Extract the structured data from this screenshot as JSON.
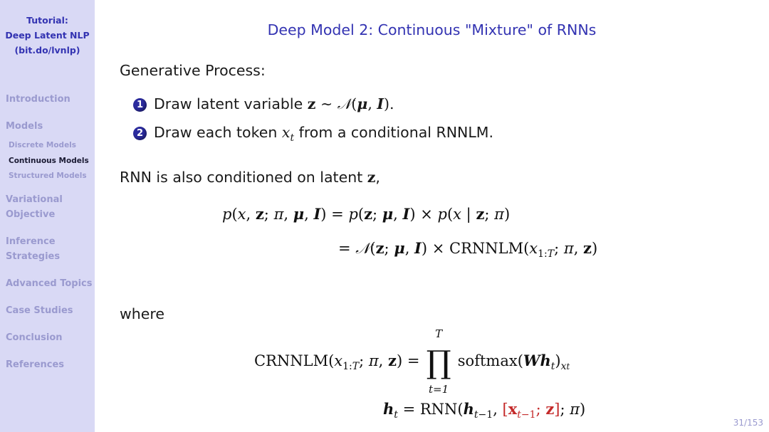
{
  "sidebar": {
    "title_lines": [
      "Tutorial:",
      "Deep Latent NLP",
      "(bit.do/lvnlp)"
    ],
    "sections": [
      {
        "label": "Introduction"
      },
      {
        "label": "Models",
        "subsections": [
          "Discrete Models",
          "Continuous Models",
          "Structured Models"
        ]
      },
      {
        "label_lines": [
          "Variational",
          "Objective"
        ]
      },
      {
        "label_lines": [
          "Inference",
          "Strategies"
        ]
      },
      {
        "label": "Advanced Topics"
      },
      {
        "label": "Case Studies"
      },
      {
        "label": "Conclusion"
      },
      {
        "label": "References"
      }
    ],
    "active_subsection": "Continuous Models"
  },
  "frame": {
    "title": "Deep Model 2: Continuous \"Mixture\" of RNNs",
    "intro": "Generative Process:",
    "steps": [
      {
        "number": "1",
        "text": "Draw latent variable",
        "math": "z ~ N(μ, I)."
      },
      {
        "number": "2",
        "text_before": "Draw each token",
        "math": "xt",
        "text_after": "from a conditional RNNLM."
      }
    ],
    "conditioning_text": "RNN is also conditioned on latent",
    "conditioning_math": "z,",
    "equation1_line1": "p(x, z; π, μ, I) = p(z; μ, I) × p(x | z; π)",
    "equation1_line2": "= N(z; μ, I) × CRNNLM(x1:T; π, z)",
    "where_label": "where",
    "equation2": "CRNNLM(x1:T; π, z) = ∏_{t=1}^{T} softmax(W h_t)_{x_t}",
    "equation3": "h_t = RNN(h_{t−1}, [x_{t−1}; z]; π)",
    "prod_upper": "T",
    "prod_lower": "t=1"
  },
  "page": {
    "current": 31,
    "total": 153,
    "label": "31/153"
  },
  "colors": {
    "sidebar_bg": "#d9d9f5",
    "title_blue": "#3333b2",
    "nav_inactive": "#9a9acf",
    "highlight_red": "#c42a2a"
  }
}
